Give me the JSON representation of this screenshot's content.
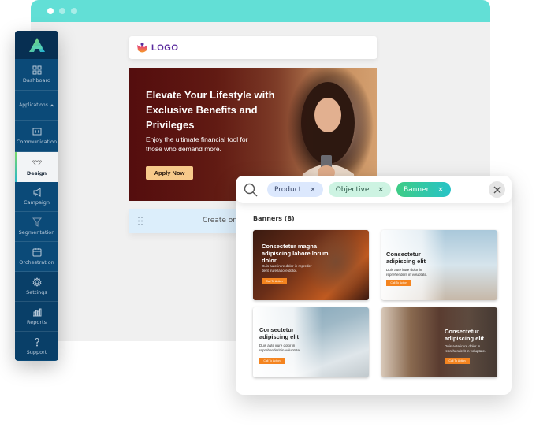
{
  "window": {
    "titlebar_color": "#62dfd6"
  },
  "sidebar": {
    "logo_icon": "brand-a-logo-icon",
    "items": [
      {
        "label": "Dashboard",
        "icon": "grid-icon"
      },
      {
        "label": "Applications",
        "icon": "chevron-up-icon"
      },
      {
        "label": "Communication",
        "icon": "message-template-icon"
      },
      {
        "label": "Design",
        "icon": "design-nodes-icon",
        "active": true
      },
      {
        "label": "Campaign",
        "icon": "megaphone-icon"
      },
      {
        "label": "Segmentation",
        "icon": "funnel-icon"
      },
      {
        "label": "Orchestration",
        "icon": "calendar-icon"
      },
      {
        "label": "Settings",
        "icon": "gear-icon"
      },
      {
        "label": "Reports",
        "icon": "bar-chart-icon"
      },
      {
        "label": "Support",
        "icon": "question-icon"
      }
    ]
  },
  "editor": {
    "logo_label": "LOGO",
    "hero": {
      "title": "Elevate Your Lifestyle with Exclusive Benefits and Privileges",
      "subtitle": "Enjoy the ultimate financial tool for those who demand more.",
      "cta": "Apply Now"
    },
    "create_bar_text": "Create or"
  },
  "search_panel": {
    "chips": [
      {
        "label": "Product",
        "remove": "×"
      },
      {
        "label": "Objective",
        "remove": "×"
      },
      {
        "label": "Banner",
        "remove": "×"
      }
    ],
    "results_title": "Banners (8)",
    "cards": [
      {
        "title": "Consectetur magna adipiscing labore lorum dolor",
        "subtitle": "Duis aute irure dolor in repreder dent irure labore dolor.",
        "cta": "Call To Action"
      },
      {
        "title": "Consectetur adipiscing elit",
        "subtitle": "Duis aute irure dolor in reprehenderit in voluptate.",
        "cta": "Call To Action"
      },
      {
        "title": "Consectetur adipiscing elit",
        "subtitle": "Duis aute irure dolor in reprehenderit in voluptate.",
        "cta": "Call To Action"
      },
      {
        "title": "Consectetur adipiscing elit",
        "subtitle": "Duis aute irure dolor in reprehenderit in voluptate.",
        "cta": "Call To Action"
      }
    ]
  }
}
